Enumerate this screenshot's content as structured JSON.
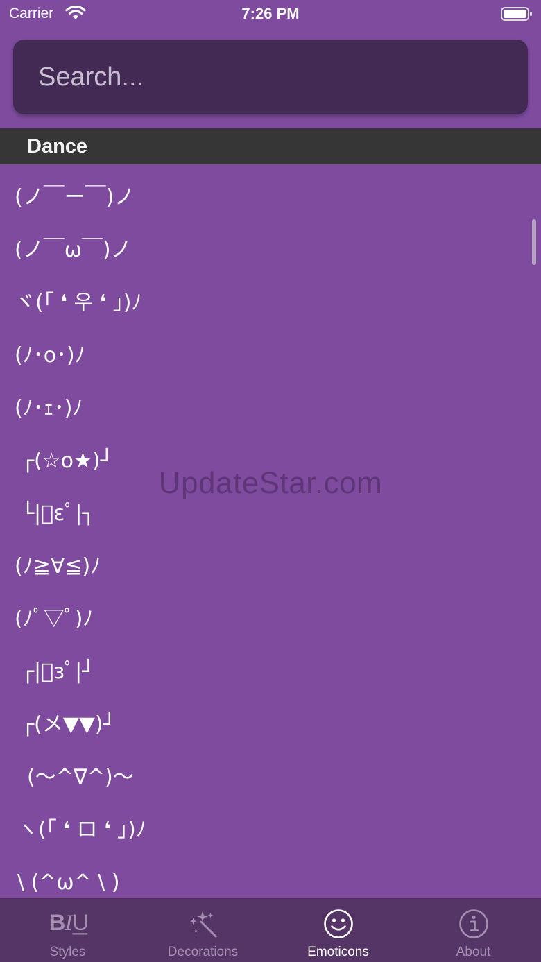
{
  "status_bar": {
    "carrier": "Carrier",
    "time": "7:26 PM"
  },
  "search": {
    "placeholder": "Search...",
    "value": ""
  },
  "section": {
    "title": "Dance"
  },
  "emoticons": [
    "(ノ￣ー￣)ノ",
    "(ノ￣ω￣)ノ",
    "ヾ(｢ ❛ 우 ❛ ｣)ﾉ",
    "(ﾉ･o･)ﾉ",
    "(ﾉ･ｪ･)ﾉ",
    "┌(☆o★)┘",
    "└|ﾟεﾟ|┐",
    "(ﾉ≧∀≦)ﾉ",
    "(ﾉﾟ▽ﾟ)ﾉ",
    "┌|ﾟзﾟ|┘",
    "┌(メ▼▼)┘",
    "(〜^∇^)〜",
    "ヽ(｢ ❛ ロ ❛ ｣)ﾉ",
    "\\ (^ω^ \\ )"
  ],
  "watermark": "UpdateStar.com",
  "tabs": [
    {
      "label": "Styles",
      "icon": "biu-icon",
      "active": false
    },
    {
      "label": "Decorations",
      "icon": "magic-wand-icon",
      "active": false
    },
    {
      "label": "Emoticons",
      "icon": "smiley-icon",
      "active": true
    },
    {
      "label": "About",
      "icon": "info-icon",
      "active": false
    }
  ],
  "colors": {
    "background": "#7f4b9f",
    "search_field": "#432a55",
    "section_header": "#363636",
    "tab_bar": "#553566",
    "tab_inactive": "#a48fb0",
    "tab_active": "#ffffff"
  }
}
